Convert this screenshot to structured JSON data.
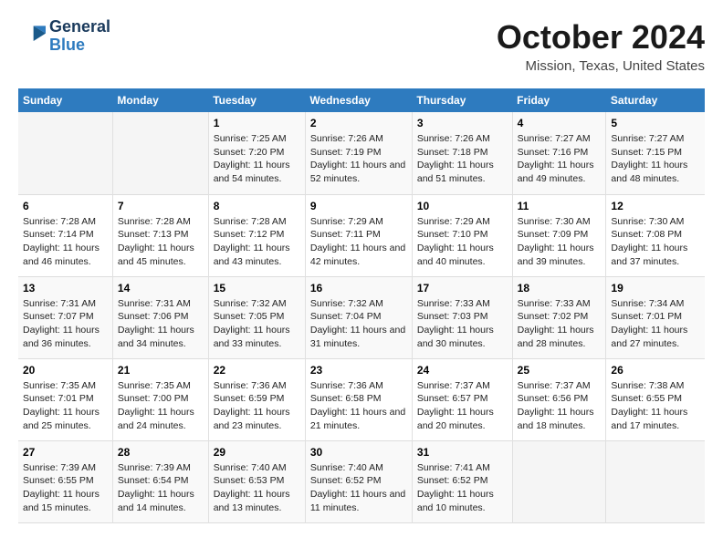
{
  "logo": {
    "line1": "General",
    "line2": "Blue"
  },
  "title": "October 2024",
  "location": "Mission, Texas, United States",
  "weekdays": [
    "Sunday",
    "Monday",
    "Tuesday",
    "Wednesday",
    "Thursday",
    "Friday",
    "Saturday"
  ],
  "weeks": [
    [
      {
        "day": "",
        "sunrise": "",
        "sunset": "",
        "daylight": ""
      },
      {
        "day": "",
        "sunrise": "",
        "sunset": "",
        "daylight": ""
      },
      {
        "day": "1",
        "sunrise": "Sunrise: 7:25 AM",
        "sunset": "Sunset: 7:20 PM",
        "daylight": "Daylight: 11 hours and 54 minutes."
      },
      {
        "day": "2",
        "sunrise": "Sunrise: 7:26 AM",
        "sunset": "Sunset: 7:19 PM",
        "daylight": "Daylight: 11 hours and 52 minutes."
      },
      {
        "day": "3",
        "sunrise": "Sunrise: 7:26 AM",
        "sunset": "Sunset: 7:18 PM",
        "daylight": "Daylight: 11 hours and 51 minutes."
      },
      {
        "day": "4",
        "sunrise": "Sunrise: 7:27 AM",
        "sunset": "Sunset: 7:16 PM",
        "daylight": "Daylight: 11 hours and 49 minutes."
      },
      {
        "day": "5",
        "sunrise": "Sunrise: 7:27 AM",
        "sunset": "Sunset: 7:15 PM",
        "daylight": "Daylight: 11 hours and 48 minutes."
      }
    ],
    [
      {
        "day": "6",
        "sunrise": "Sunrise: 7:28 AM",
        "sunset": "Sunset: 7:14 PM",
        "daylight": "Daylight: 11 hours and 46 minutes."
      },
      {
        "day": "7",
        "sunrise": "Sunrise: 7:28 AM",
        "sunset": "Sunset: 7:13 PM",
        "daylight": "Daylight: 11 hours and 45 minutes."
      },
      {
        "day": "8",
        "sunrise": "Sunrise: 7:28 AM",
        "sunset": "Sunset: 7:12 PM",
        "daylight": "Daylight: 11 hours and 43 minutes."
      },
      {
        "day": "9",
        "sunrise": "Sunrise: 7:29 AM",
        "sunset": "Sunset: 7:11 PM",
        "daylight": "Daylight: 11 hours and 42 minutes."
      },
      {
        "day": "10",
        "sunrise": "Sunrise: 7:29 AM",
        "sunset": "Sunset: 7:10 PM",
        "daylight": "Daylight: 11 hours and 40 minutes."
      },
      {
        "day": "11",
        "sunrise": "Sunrise: 7:30 AM",
        "sunset": "Sunset: 7:09 PM",
        "daylight": "Daylight: 11 hours and 39 minutes."
      },
      {
        "day": "12",
        "sunrise": "Sunrise: 7:30 AM",
        "sunset": "Sunset: 7:08 PM",
        "daylight": "Daylight: 11 hours and 37 minutes."
      }
    ],
    [
      {
        "day": "13",
        "sunrise": "Sunrise: 7:31 AM",
        "sunset": "Sunset: 7:07 PM",
        "daylight": "Daylight: 11 hours and 36 minutes."
      },
      {
        "day": "14",
        "sunrise": "Sunrise: 7:31 AM",
        "sunset": "Sunset: 7:06 PM",
        "daylight": "Daylight: 11 hours and 34 minutes."
      },
      {
        "day": "15",
        "sunrise": "Sunrise: 7:32 AM",
        "sunset": "Sunset: 7:05 PM",
        "daylight": "Daylight: 11 hours and 33 minutes."
      },
      {
        "day": "16",
        "sunrise": "Sunrise: 7:32 AM",
        "sunset": "Sunset: 7:04 PM",
        "daylight": "Daylight: 11 hours and 31 minutes."
      },
      {
        "day": "17",
        "sunrise": "Sunrise: 7:33 AM",
        "sunset": "Sunset: 7:03 PM",
        "daylight": "Daylight: 11 hours and 30 minutes."
      },
      {
        "day": "18",
        "sunrise": "Sunrise: 7:33 AM",
        "sunset": "Sunset: 7:02 PM",
        "daylight": "Daylight: 11 hours and 28 minutes."
      },
      {
        "day": "19",
        "sunrise": "Sunrise: 7:34 AM",
        "sunset": "Sunset: 7:01 PM",
        "daylight": "Daylight: 11 hours and 27 minutes."
      }
    ],
    [
      {
        "day": "20",
        "sunrise": "Sunrise: 7:35 AM",
        "sunset": "Sunset: 7:01 PM",
        "daylight": "Daylight: 11 hours and 25 minutes."
      },
      {
        "day": "21",
        "sunrise": "Sunrise: 7:35 AM",
        "sunset": "Sunset: 7:00 PM",
        "daylight": "Daylight: 11 hours and 24 minutes."
      },
      {
        "day": "22",
        "sunrise": "Sunrise: 7:36 AM",
        "sunset": "Sunset: 6:59 PM",
        "daylight": "Daylight: 11 hours and 23 minutes."
      },
      {
        "day": "23",
        "sunrise": "Sunrise: 7:36 AM",
        "sunset": "Sunset: 6:58 PM",
        "daylight": "Daylight: 11 hours and 21 minutes."
      },
      {
        "day": "24",
        "sunrise": "Sunrise: 7:37 AM",
        "sunset": "Sunset: 6:57 PM",
        "daylight": "Daylight: 11 hours and 20 minutes."
      },
      {
        "day": "25",
        "sunrise": "Sunrise: 7:37 AM",
        "sunset": "Sunset: 6:56 PM",
        "daylight": "Daylight: 11 hours and 18 minutes."
      },
      {
        "day": "26",
        "sunrise": "Sunrise: 7:38 AM",
        "sunset": "Sunset: 6:55 PM",
        "daylight": "Daylight: 11 hours and 17 minutes."
      }
    ],
    [
      {
        "day": "27",
        "sunrise": "Sunrise: 7:39 AM",
        "sunset": "Sunset: 6:55 PM",
        "daylight": "Daylight: 11 hours and 15 minutes."
      },
      {
        "day": "28",
        "sunrise": "Sunrise: 7:39 AM",
        "sunset": "Sunset: 6:54 PM",
        "daylight": "Daylight: 11 hours and 14 minutes."
      },
      {
        "day": "29",
        "sunrise": "Sunrise: 7:40 AM",
        "sunset": "Sunset: 6:53 PM",
        "daylight": "Daylight: 11 hours and 13 minutes."
      },
      {
        "day": "30",
        "sunrise": "Sunrise: 7:40 AM",
        "sunset": "Sunset: 6:52 PM",
        "daylight": "Daylight: 11 hours and 11 minutes."
      },
      {
        "day": "31",
        "sunrise": "Sunrise: 7:41 AM",
        "sunset": "Sunset: 6:52 PM",
        "daylight": "Daylight: 11 hours and 10 minutes."
      },
      {
        "day": "",
        "sunrise": "",
        "sunset": "",
        "daylight": ""
      },
      {
        "day": "",
        "sunrise": "",
        "sunset": "",
        "daylight": ""
      }
    ]
  ]
}
